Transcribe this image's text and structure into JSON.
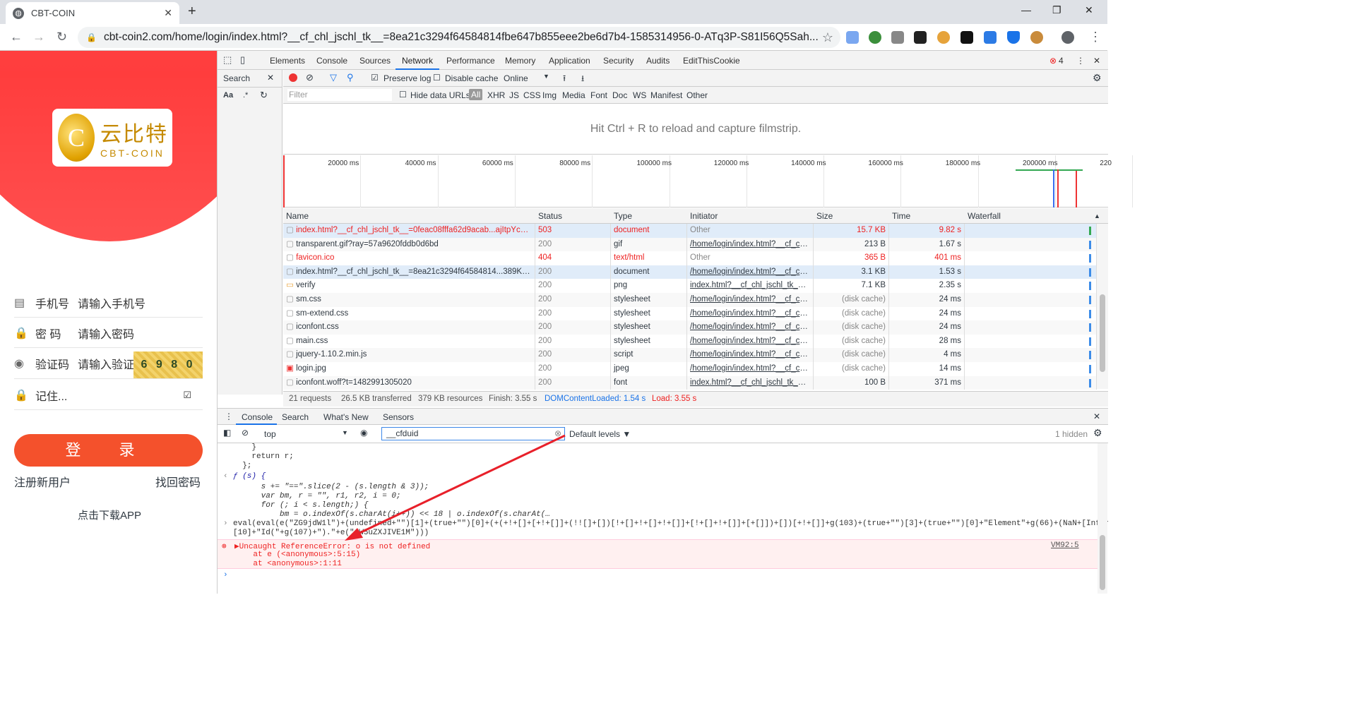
{
  "browser": {
    "tab_title": "CBT-COIN",
    "url": "cbt-coin2.com/home/login/index.html?__cf_chl_jschl_tk__=8ea21c3294f64584814fbe647b855eee2be6d7b4-1585314956-0-ATq3P-S81I56Q5Sah..."
  },
  "page": {
    "logo_cn": "云比特",
    "logo_en": "CBT-COIN",
    "coin_letter": "C",
    "phone_label": "手机号",
    "phone_placeholder": "请输入手机号",
    "pwd_label": "密 码",
    "pwd_placeholder": "请输入密码",
    "code_label": "验证码",
    "code_placeholder": "请输入验证",
    "captcha_text": "6 9 8 0",
    "remember": "记住...",
    "login_button": "登 录",
    "register": "注册新用户",
    "forgot": "找回密码",
    "download": "点击下载APP"
  },
  "devtools": {
    "tabs": [
      "Elements",
      "Console",
      "Sources",
      "Network",
      "Performance",
      "Memory",
      "Application",
      "Security",
      "Audits",
      "EditThisCookie"
    ],
    "active_tab": "Network",
    "error_count": "4",
    "search_label": "Search",
    "preserve_log": "Preserve log",
    "disable_cache": "Disable cache",
    "throttle": "Online",
    "filter_placeholder": "Filter",
    "hide_data_urls": "Hide data URLs",
    "filter_types": [
      "All",
      "XHR",
      "JS",
      "CSS",
      "Img",
      "Media",
      "Font",
      "Doc",
      "WS",
      "Manifest",
      "Other"
    ],
    "filmstrip_msg": "Hit Ctrl + R to reload and capture filmstrip.",
    "timeline_ticks": [
      "20000 ms",
      "40000 ms",
      "60000 ms",
      "80000 ms",
      "100000 ms",
      "120000 ms",
      "140000 ms",
      "160000 ms",
      "180000 ms",
      "200000 ms",
      "220"
    ],
    "columns": [
      "Name",
      "Status",
      "Type",
      "Initiator",
      "Size",
      "Time",
      "Waterfall"
    ],
    "rows": [
      {
        "name": "index.html?__cf_chl_jschl_tk__=0feac08fffa62d9acab...ajItpYcFhEHd...",
        "status": "503",
        "type": "document",
        "initiator": "Other",
        "size": "15.7 KB",
        "time": "9.82 s",
        "err": true
      },
      {
        "name": "transparent.gif?ray=57a9620fddb0d6bd",
        "status": "200",
        "type": "gif",
        "initiator": "/home/login/index.html?__cf_chl_...",
        "size": "213 B",
        "time": "1.67 s"
      },
      {
        "name": "favicon.ico",
        "status": "404",
        "type": "text/html",
        "initiator": "Other",
        "size": "365 B",
        "time": "401 ms",
        "err": true
      },
      {
        "name": "index.html?__cf_chl_jschl_tk__=8ea21c3294f64584814...389KG1yap...",
        "status": "200",
        "type": "document",
        "initiator": "/home/login/index.html?__cf_chl_...",
        "size": "3.1 KB",
        "time": "1.53 s"
      },
      {
        "name": "verify",
        "status": "200",
        "type": "png",
        "initiator": "index.html?__cf_chl_jschl_tk__=8e...",
        "size": "7.1 KB",
        "time": "2.35 s"
      },
      {
        "name": "sm.css",
        "status": "200",
        "type": "stylesheet",
        "initiator": "/home/login/index.html?__cf_chl_...",
        "size": "(disk cache)",
        "time": "24 ms"
      },
      {
        "name": "sm-extend.css",
        "status": "200",
        "type": "stylesheet",
        "initiator": "/home/login/index.html?__cf_chl_...",
        "size": "(disk cache)",
        "time": "24 ms"
      },
      {
        "name": "iconfont.css",
        "status": "200",
        "type": "stylesheet",
        "initiator": "/home/login/index.html?__cf_chl_...",
        "size": "(disk cache)",
        "time": "24 ms"
      },
      {
        "name": "main.css",
        "status": "200",
        "type": "stylesheet",
        "initiator": "/home/login/index.html?__cf_chl_...",
        "size": "(disk cache)",
        "time": "28 ms"
      },
      {
        "name": "jquery-1.10.2.min.js",
        "status": "200",
        "type": "script",
        "initiator": "/home/login/index.html?__cf_chl_...",
        "size": "(disk cache)",
        "time": "4 ms"
      },
      {
        "name": "login.jpg",
        "status": "200",
        "type": "jpeg",
        "initiator": "/home/login/index.html?__cf_chl_...",
        "size": "(disk cache)",
        "time": "14 ms"
      },
      {
        "name": "iconfont.woff?t=1482991305020",
        "status": "200",
        "type": "font",
        "initiator": "index.html?__cf_chl_jschl_tk__=8e...",
        "size": "100 B",
        "time": "371 ms"
      }
    ],
    "summary": {
      "requests": "21 requests",
      "transferred": "26.5 KB transferred",
      "resources": "379 KB resources",
      "finish": "Finish: 3.55 s",
      "dcl": "DOMContentLoaded: 1.54 s",
      "load": "Load: 3.55 s"
    },
    "drawer_tabs": [
      "Console",
      "Search",
      "What's New",
      "Sensors"
    ],
    "context": "top",
    "console_filter": "__cfduid",
    "levels": "Default levels ▼",
    "hidden": "1 hidden",
    "console_lines": [
      "    }",
      "    return r;",
      "  };",
      "ƒ (s) {",
      "      s += \"==\".slice(2 - (s.length & 3));",
      "      var bm, r = \"\", r1, r2, i = 0;",
      "      for (; i < s.length;) {",
      "          bm = o.indexOf(s.charAt(i++)) << 18 | o.indexOf(s.charAt(…",
      "eval(eval(e(\"ZG9jdW1l\")+(undefined+\"\")[1]+(true+\"\")[0]+(+(+!+[]+[+!+[]]+(!![]+[])[!+[]+!+[]+!+[]]+[!+[]+!+[]]+[+[]])+[])[+!+[]]+g(103)+(true+\"\")[3]+(true+\"\")[0]+\"Element\"+g(66)+(NaN+[Infinity])",
      "[10]+\"Id(\"+g(107)+\").\"+e(\"aW5uZXJIVE1M\")))"
    ],
    "error_lines": [
      "▶Uncaught ReferenceError: o is not defined",
      "    at e (<anonymous>:5:15)",
      "    at <anonymous>:1:11"
    ],
    "error_source": "VM92:5",
    "colors": {
      "accent": "#1a73e8",
      "error": "#e22",
      "login": "#f4512c",
      "hero": "#ff4a55"
    }
  }
}
